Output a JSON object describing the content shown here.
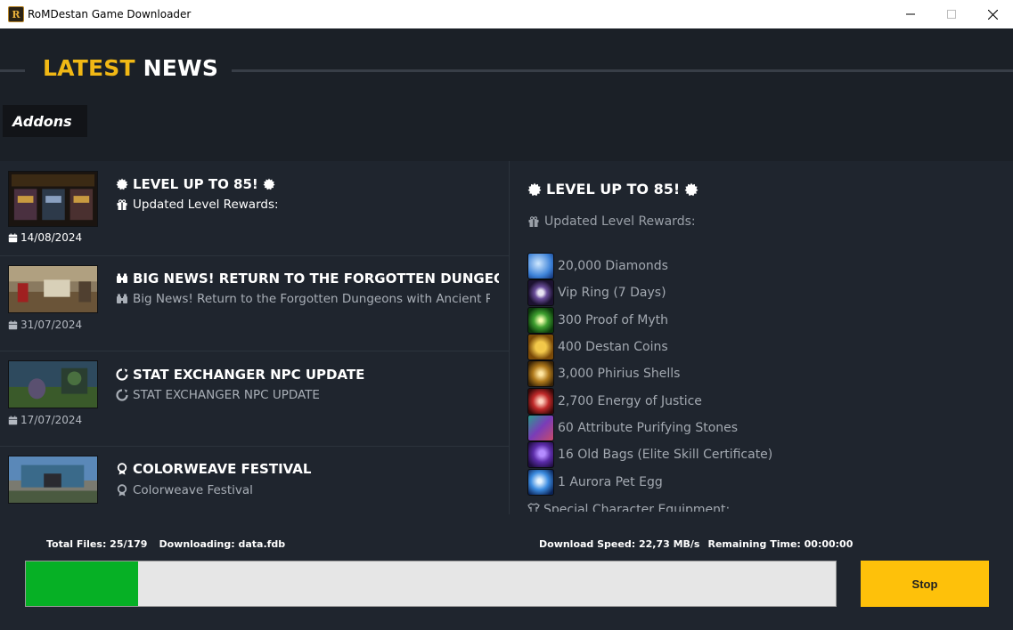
{
  "window": {
    "title": "RoMDestan Game Downloader",
    "icon_letter": "R"
  },
  "header": {
    "title_word1": "LATEST",
    "title_word2": "NEWS",
    "addons_label": "Addons"
  },
  "news": [
    {
      "title": "LEVEL UP TO 85!",
      "title_icon": "gear-icon",
      "subtitle": "Updated Level Rewards:",
      "sub_icon": "gift-icon",
      "date": "14/08/2024"
    },
    {
      "title": "BIG NEWS! RETURN TO THE FORGOTTEN DUNGEONS WITH ANCIENT",
      "title_icon": "binoculars-icon",
      "subtitle": "Big News! Return to the Forgotten Dungeons with Ancient Relics",
      "sub_icon": "binoculars-icon",
      "date": "31/07/2024"
    },
    {
      "title": "STAT EXCHANGER NPC UPDATE",
      "title_icon": "refresh-icon",
      "subtitle": "STAT EXCHANGER NPC UPDATE",
      "sub_icon": "refresh-icon",
      "date": "17/07/2024"
    },
    {
      "title": "COLORWEAVE FESTIVAL",
      "title_icon": "award-icon",
      "subtitle": "Colorweave Festival",
      "sub_icon": "award-icon",
      "date": ""
    }
  ],
  "detail": {
    "title": "LEVEL UP TO 85!",
    "subtitle": "Updated Level Rewards:",
    "rewards": [
      {
        "label": "20,000 Diamonds",
        "icon": "diamond-icon"
      },
      {
        "label": "Vip Ring (7 Days)",
        "icon": "ring-icon"
      },
      {
        "label": "300 Proof of Myth",
        "icon": "myth-swirl-icon"
      },
      {
        "label": "400 Destan Coins",
        "icon": "coin-icon"
      },
      {
        "label": "3,000 Phirius Shells",
        "icon": "shell-swirl-icon"
      },
      {
        "label": "2,700 Energy of Justice",
        "icon": "justice-swirl-icon"
      },
      {
        "label": "60 Attribute Purifying Stones",
        "icon": "stone-icon"
      },
      {
        "label": "16 Old Bags (Elite Skill Certificate)",
        "icon": "bag-icon"
      },
      {
        "label": "1 Aurora Pet Egg",
        "icon": "egg-icon"
      }
    ],
    "cut_line": "Special Character Equipment:"
  },
  "status": {
    "total_files": "Total Files: 25/179",
    "downloading": "Downloading: data.fdb",
    "speed": "Download Speed: 22,73 MB/s",
    "remaining": "Remaining Time: 00:00:00"
  },
  "progress": {
    "fraction": 0.1386
  },
  "stop_label": "Stop",
  "colors": {
    "accent": "#f1b815",
    "progress": "#06b025",
    "button": "#fec10a",
    "bg": "#1f252e"
  }
}
